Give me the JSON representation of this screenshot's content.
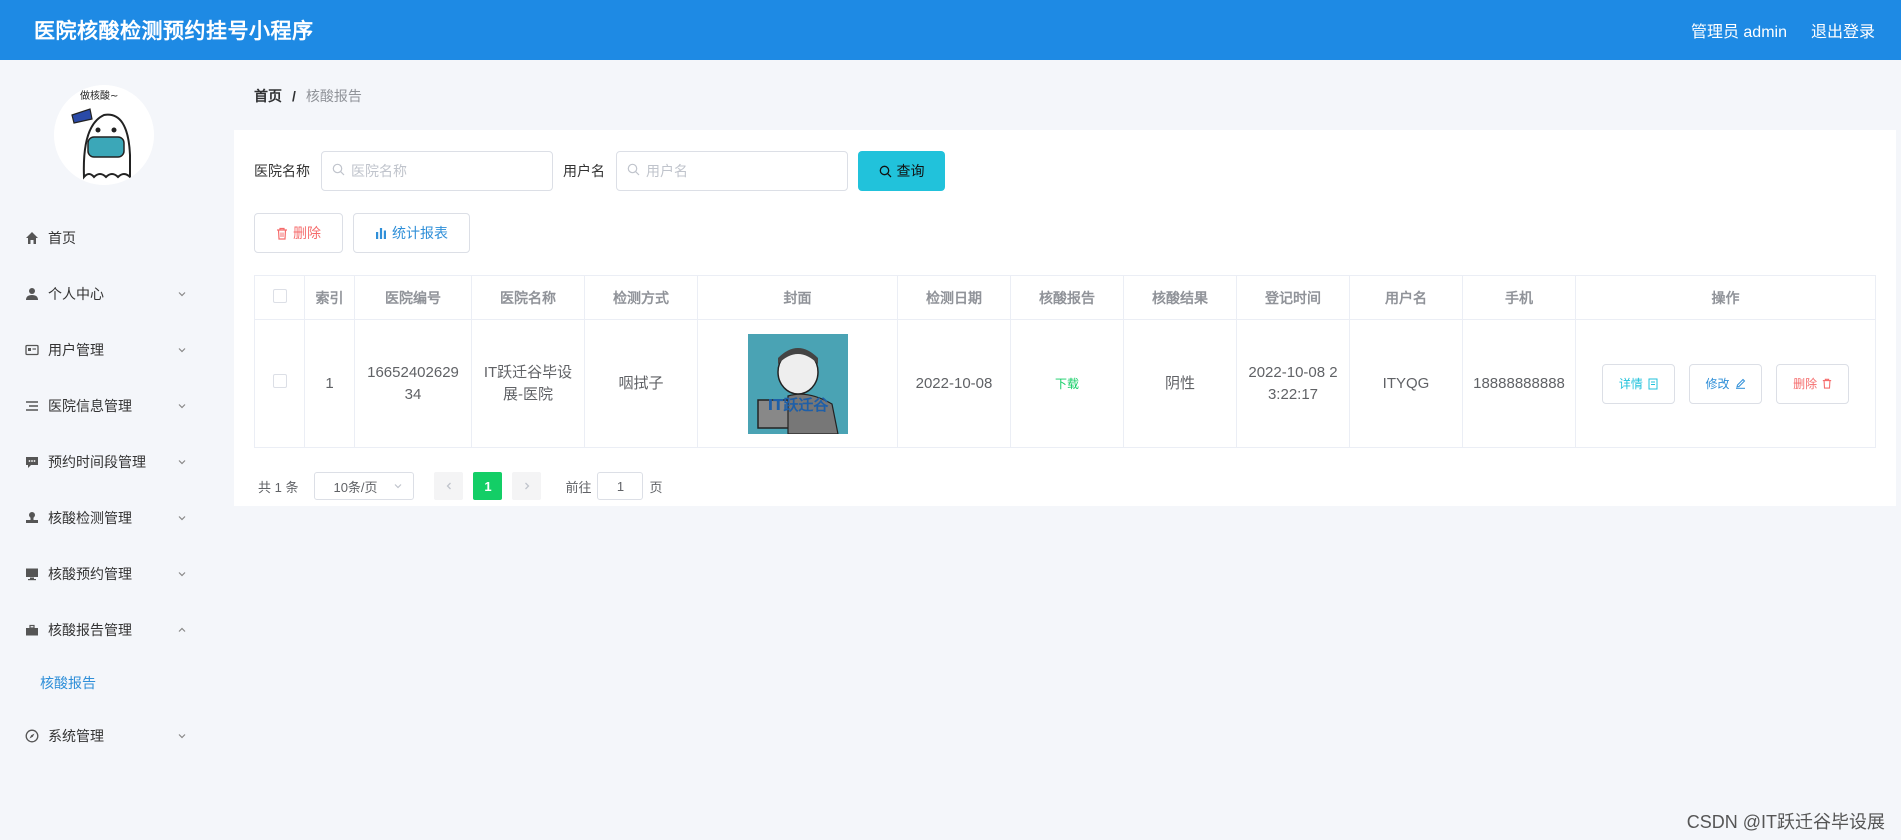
{
  "header": {
    "app_title": "医院核酸检测预约挂号小程序",
    "role_label": "管理员 admin",
    "logout_label": "退出登录"
  },
  "sidebar": {
    "logo_icon": "ghost-mascot-logo",
    "items": [
      {
        "label": "首页",
        "icon": "home-icon",
        "expandable": false
      },
      {
        "label": "个人中心",
        "icon": "user-icon",
        "expandable": true
      },
      {
        "label": "用户管理",
        "icon": "id-card-icon",
        "expandable": true
      },
      {
        "label": "医院信息管理",
        "icon": "list-icon",
        "expandable": true
      },
      {
        "label": "预约时间段管理",
        "icon": "message-icon",
        "expandable": true
      },
      {
        "label": "核酸检测管理",
        "icon": "stamp-icon",
        "expandable": true
      },
      {
        "label": "核酸预约管理",
        "icon": "monitor-icon",
        "expandable": true
      },
      {
        "label": "核酸报告管理",
        "icon": "suitcase-icon",
        "expandable": true,
        "expanded": true
      },
      {
        "label": "系统管理",
        "icon": "compass-icon",
        "expandable": true
      }
    ],
    "submenu_active": "核酸报告"
  },
  "breadcrumb": {
    "home": "首页",
    "separator": "/",
    "current": "核酸报告"
  },
  "search": {
    "hospital_label": "医院名称",
    "hospital_placeholder": "医院名称",
    "hospital_value": "",
    "user_label": "用户名",
    "user_placeholder": "用户名",
    "user_value": "",
    "query_button": "查询"
  },
  "actions": {
    "delete_button": "删除",
    "stats_button": "统计报表"
  },
  "table": {
    "columns": [
      "索引",
      "医院编号",
      "医院名称",
      "检测方式",
      "封面",
      "检测日期",
      "核酸报告",
      "核酸结果",
      "登记时间",
      "用户名",
      "手机",
      "操作"
    ],
    "rows": [
      {
        "index": "1",
        "hospital_no": "1665240262934",
        "hospital_name": "IT跃迁谷毕设展-医院",
        "method": "咽拭子",
        "cover_caption": "IT跃迁谷",
        "test_date": "2022-10-08",
        "report_link": "下载",
        "result": "阴性",
        "register_time": "2022-10-08 23:22:17",
        "username": "ITYQG",
        "phone": "18888888888",
        "detail_label": "详情",
        "edit_label": "修改",
        "delete_label": "删除"
      }
    ]
  },
  "pagination": {
    "total_text": "共 1 条",
    "page_size": "10条/页",
    "current_page": "1",
    "goto_prefix": "前往",
    "goto_value": "1",
    "goto_suffix": "页"
  },
  "watermark": "CSDN @IT跃迁谷毕设展",
  "colors": {
    "header_bg": "#1e8ae4",
    "query_btn": "#21c2db",
    "active_page": "#13ce66",
    "danger": "#f56c6c",
    "link": "#2f8fd8"
  }
}
